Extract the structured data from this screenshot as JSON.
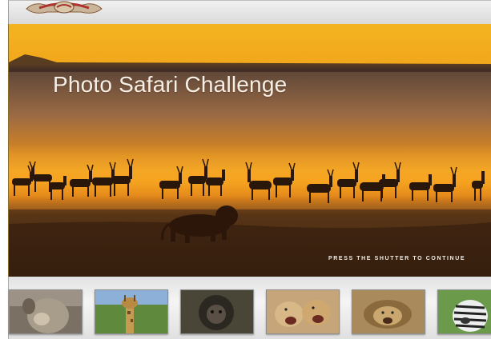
{
  "game": {
    "title": "Photo Safari Challenge",
    "prompt": "PRESS THE SHUTTER TO CONTINUE",
    "logo_icon": "crest-logo-icon"
  },
  "thumbnails": [
    {
      "icon": "monkey-photo-icon",
      "subject": "baboon"
    },
    {
      "icon": "giraffe-photo-icon",
      "subject": "giraffe"
    },
    {
      "icon": "gorilla-photo-icon",
      "subject": "gorilla"
    },
    {
      "icon": "cheetah-photo-icon",
      "subject": "cheetahs"
    },
    {
      "icon": "lion-photo-icon",
      "subject": "lion"
    },
    {
      "icon": "zebra-photo-icon",
      "subject": "zebra"
    }
  ],
  "colors": {
    "sky_top": "#f0b01c",
    "sky_mid": "#e98a1a",
    "ground": "#3b2210",
    "title": "#f6efe6"
  }
}
